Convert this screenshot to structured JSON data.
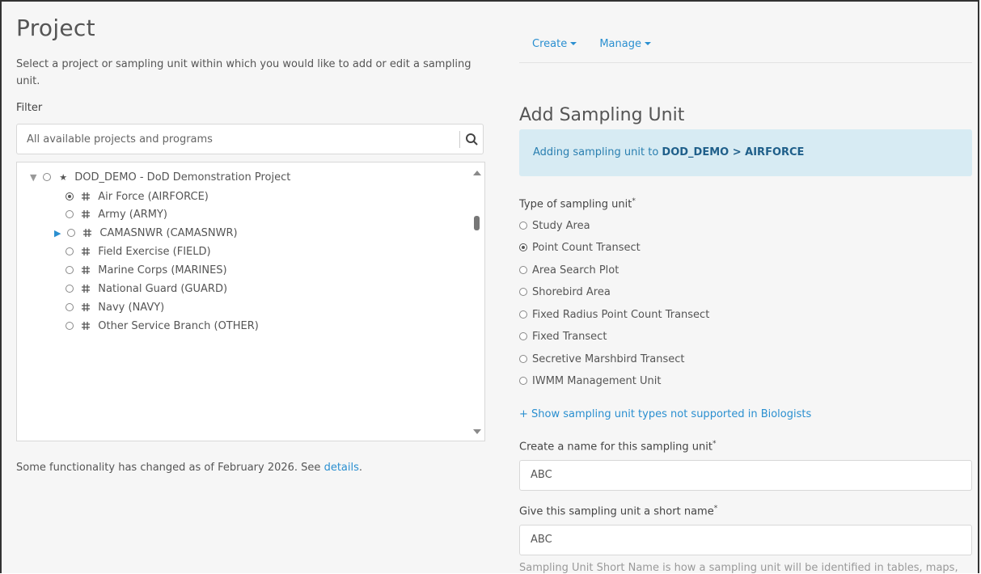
{
  "left": {
    "title": "Project",
    "description": "Select a project or sampling unit within which you would like to add or edit a sampling unit.",
    "filter_label": "Filter",
    "search": {
      "value": "",
      "placeholder": "All available projects and programs"
    },
    "tree": {
      "root": {
        "label": "DOD_DEMO - DoD Demonstration Project",
        "expanded": true
      },
      "items": [
        {
          "label": "Air Force (AIRFORCE)",
          "selected": true,
          "expandable": false
        },
        {
          "label": "Army (ARMY)",
          "selected": false,
          "expandable": false
        },
        {
          "label": "CAMASNWR (CAMASNWR)",
          "selected": false,
          "expandable": true
        },
        {
          "label": "Field Exercise (FIELD)",
          "selected": false,
          "expandable": false
        },
        {
          "label": "Marine Corps (MARINES)",
          "selected": false,
          "expandable": false
        },
        {
          "label": "National Guard (GUARD)",
          "selected": false,
          "expandable": false
        },
        {
          "label": "Navy (NAVY)",
          "selected": false,
          "expandable": false
        },
        {
          "label": "Other Service Branch (OTHER)",
          "selected": false,
          "expandable": false
        }
      ]
    },
    "notice_text": "Some functionality has changed as of February 2026. See ",
    "notice_link": "details",
    "notice_end": "."
  },
  "right": {
    "menu": {
      "create": "Create",
      "manage": "Manage"
    },
    "section_title": "Add Sampling Unit",
    "alert": {
      "prefix": "Adding sampling unit to ",
      "path": "DOD_DEMO > AIRFORCE"
    },
    "type_label": "Type of sampling unit",
    "required_mark": "*",
    "types": [
      {
        "label": "Study Area",
        "selected": false
      },
      {
        "label": "Point Count Transect",
        "selected": true
      },
      {
        "label": "Area Search Plot",
        "selected": false
      },
      {
        "label": "Shorebird Area",
        "selected": false
      },
      {
        "label": "Fixed Radius Point Count Transect",
        "selected": false
      },
      {
        "label": "Fixed Transect",
        "selected": false
      },
      {
        "label": "Secretive Marshbird Transect",
        "selected": false
      },
      {
        "label": "IWMM Management Unit",
        "selected": false
      }
    ],
    "more_types_link": "+ Show sampling unit types not supported in Biologists",
    "name_label": "Create a name for this sampling unit",
    "name_value": "ABC",
    "short_label": "Give this sampling unit a short name",
    "short_value": "ABC",
    "help_text": "Sampling Unit Short Name is how a sampling unit will be identified in tables, maps,"
  },
  "colors": {
    "accent": "#2a8fd0",
    "alert_bg": "#d7ebf3",
    "page_bg": "#f6f6f6"
  }
}
